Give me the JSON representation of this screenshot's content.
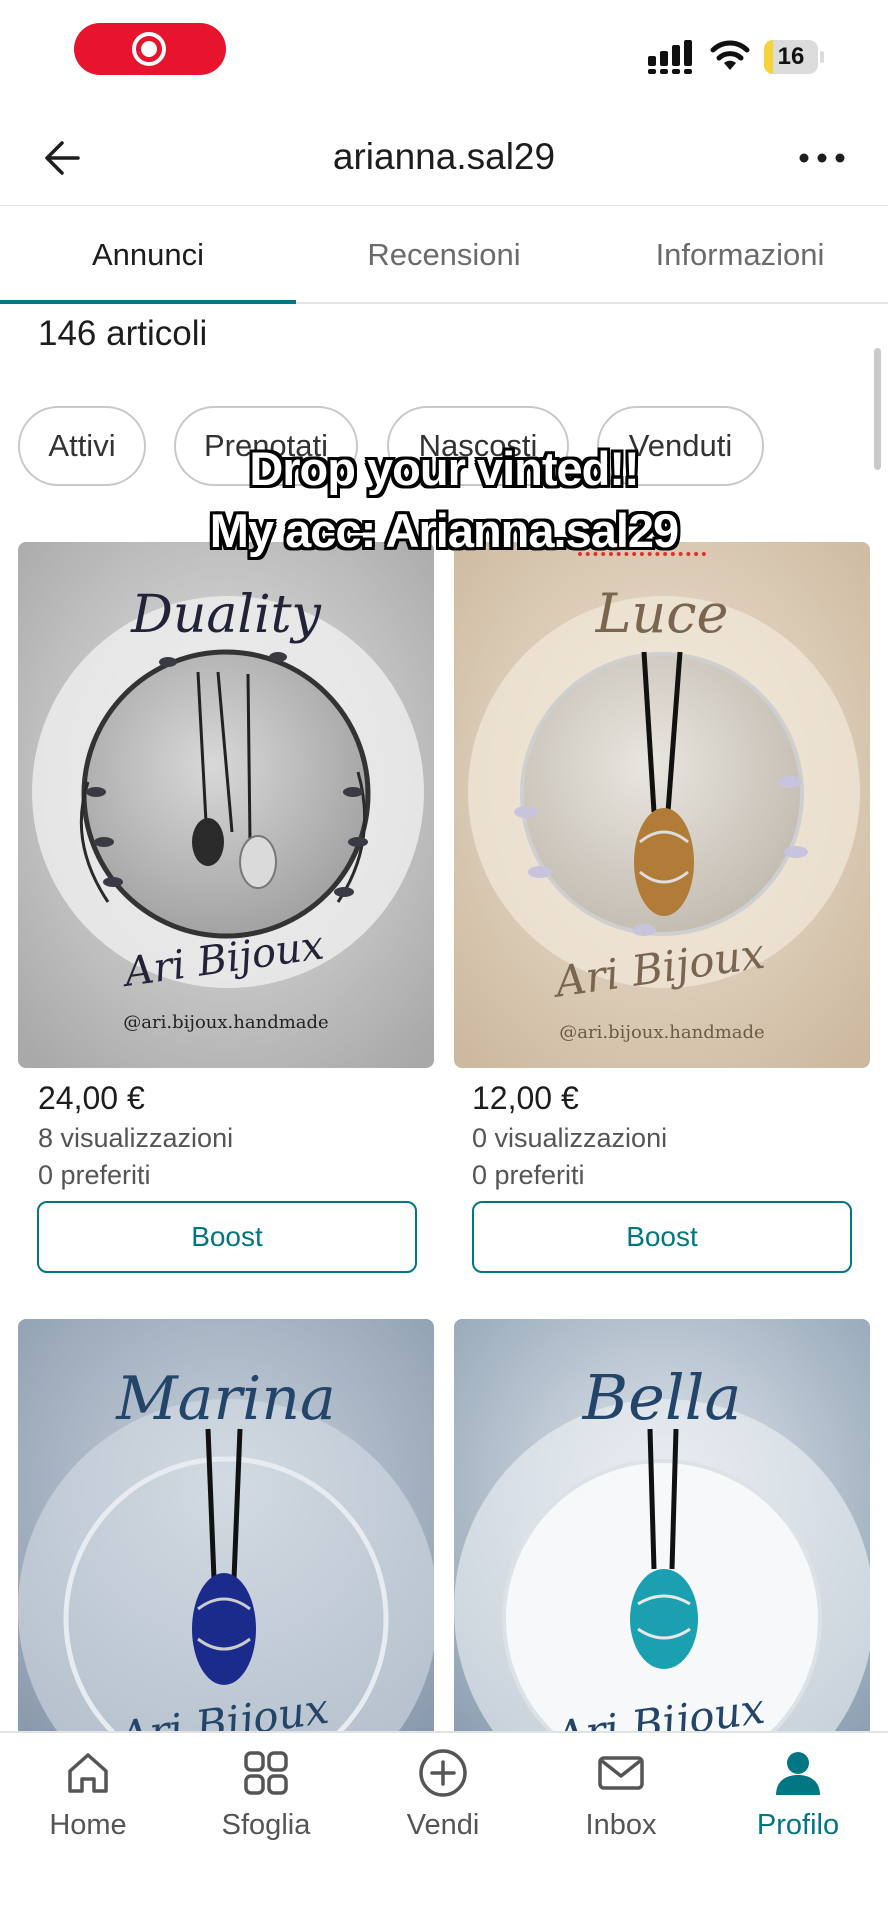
{
  "status_bar": {
    "battery_level": "16",
    "battery_fraction": 0.16,
    "recording": true
  },
  "header": {
    "title": "arianna.sal29",
    "back_icon": "arrow-left-icon",
    "more_icon": "more-horizontal-icon"
  },
  "tabs": [
    {
      "label": "Annunci",
      "active": true
    },
    {
      "label": "Recensioni",
      "active": false
    },
    {
      "label": "Informazioni",
      "active": false
    }
  ],
  "item_count": "146 articoli",
  "filters": [
    {
      "label": "Attivi"
    },
    {
      "label": "Prenotati"
    },
    {
      "label": "Nascosti"
    },
    {
      "label": "Venduti"
    }
  ],
  "overlay_caption": {
    "line1": "Drop your vinted!!",
    "line2": "My acc: Arianna.sal29"
  },
  "products": [
    {
      "image_title": "Duality",
      "image_brand": "Ari Bijoux",
      "image_handle": "@ari.bijoux.handmade",
      "price": "24,00 €",
      "views": "8 visualizzazioni",
      "favorites": "0 preferiti",
      "boost_label": "Boost",
      "accent": "#3b3b45"
    },
    {
      "image_title": "Luce",
      "image_brand": "Ari Bijoux",
      "image_handle": "@ari.bijoux.handmade",
      "price": "12,00 €",
      "views": "0 visualizzazioni",
      "favorites": "0 preferiti",
      "boost_label": "Boost",
      "accent": "#a0703a"
    },
    {
      "image_title": "Marina",
      "image_brand": "Ari Bijoux",
      "accent": "#1a2b8c"
    },
    {
      "image_title": "Bella",
      "image_brand": "Ari Bijoux",
      "accent": "#1aa0b0"
    }
  ],
  "bottom_nav": [
    {
      "label": "Home",
      "icon": "home-icon",
      "active": false
    },
    {
      "label": "Sfoglia",
      "icon": "grid-icon",
      "active": false
    },
    {
      "label": "Vendi",
      "icon": "plus-circle-icon",
      "active": false
    },
    {
      "label": "Inbox",
      "icon": "mail-icon",
      "active": false
    },
    {
      "label": "Profilo",
      "icon": "profile-icon",
      "active": true
    }
  ],
  "colors": {
    "brand": "#007782",
    "record": "#e8132d",
    "battery": "#f5d33a"
  }
}
